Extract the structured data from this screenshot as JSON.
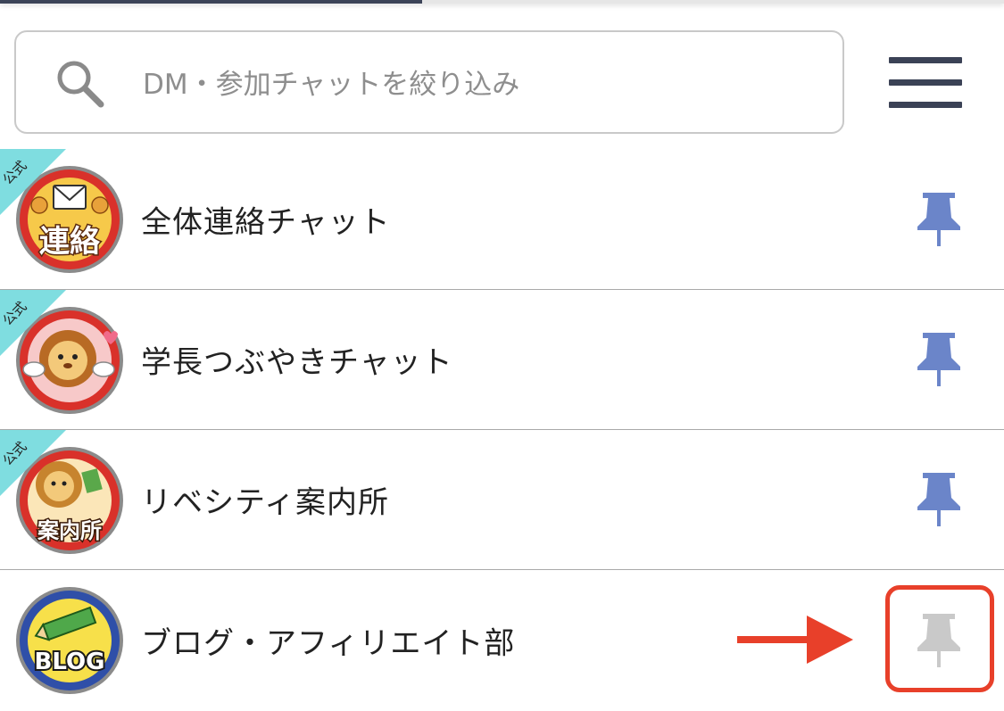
{
  "top_bar": {
    "progress_percent": 42
  },
  "search": {
    "placeholder": "DM・参加チャットを絞り込み",
    "value": ""
  },
  "icons": {
    "search": "search-icon",
    "menu": "hamburger-menu-icon",
    "pin": "pin-icon",
    "annotation_arrow": "arrow-right-icon"
  },
  "colors": {
    "pin_active": "#6b85c9",
    "pin_inactive": "#c9c9c9",
    "official_tag": "#7fdde0",
    "annotation": "#e8402a",
    "menu": "#3b4256"
  },
  "chats": [
    {
      "title": "全体連絡チャット",
      "official": true,
      "official_label": "公式",
      "avatar_text": "連絡",
      "pinned": true
    },
    {
      "title": "学長つぶやきチャット",
      "official": true,
      "official_label": "公式",
      "avatar_text": "",
      "pinned": true
    },
    {
      "title": "リベシティ案内所",
      "official": true,
      "official_label": "公式",
      "avatar_text": "案内所",
      "pinned": true
    },
    {
      "title": "ブログ・アフィリエイト部",
      "official": false,
      "official_label": "",
      "avatar_text": "BLOG",
      "pinned": false
    }
  ]
}
